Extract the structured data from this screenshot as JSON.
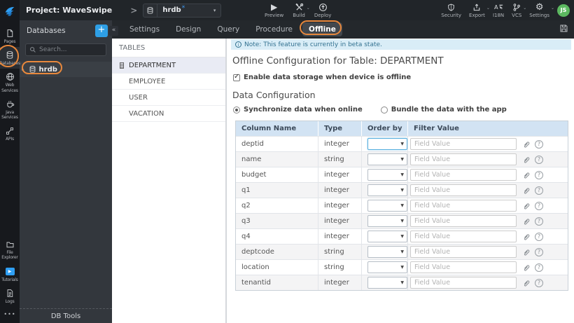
{
  "topbar": {
    "project_label": "Project: WaveSwipe",
    "breadcrumb_separator": ">",
    "db_selector": {
      "value": "hrdb",
      "unsaved_marker": "*",
      "caret": "▾"
    },
    "actions": [
      {
        "label": "Preview",
        "icon": "play-icon"
      },
      {
        "label": "Build",
        "icon": "tools-icon",
        "has_caret": true
      },
      {
        "label": "Deploy",
        "icon": "deploy-circle-up-icon"
      }
    ],
    "utilities": [
      {
        "label": "Security",
        "icon": "shield-icon"
      },
      {
        "label": "Export",
        "icon": "export-up-icon",
        "has_caret": true
      },
      {
        "label": "I18N",
        "icon": "translate-icon"
      },
      {
        "label": "VCS",
        "icon": "branch-icon",
        "has_caret": true
      },
      {
        "label": "Settings",
        "icon": "gear-icon",
        "has_caret": true
      }
    ],
    "avatar_initials": "JS",
    "caret_glyph": "⌄"
  },
  "activity_bar": {
    "items": [
      {
        "label": "Pages",
        "icon": "page-icon"
      },
      {
        "label": "Databases",
        "icon": "database-icon",
        "active": true
      },
      {
        "label": "Web Services",
        "icon": "globe-icon"
      },
      {
        "label": "Java Services",
        "icon": "coffee-icon"
      },
      {
        "label": "APIs",
        "icon": "nodes-icon"
      }
    ],
    "bottom_items": [
      {
        "label": "File Explorer",
        "icon": "folder-icon"
      },
      {
        "label": "Tutorials",
        "icon": "play-badge-icon"
      },
      {
        "label": "Logs",
        "icon": "log-file-icon"
      }
    ],
    "overflow": "•••"
  },
  "db_panel": {
    "title": "Databases",
    "add_button": "+",
    "collapse_button": "«",
    "search_placeholder": "Search...",
    "expander_glyph": "▸",
    "items": [
      {
        "label": "hrdb"
      }
    ],
    "footer": "DB Tools"
  },
  "tabs": {
    "items": [
      {
        "label": "Settings"
      },
      {
        "label": "Design"
      },
      {
        "label": "Query"
      },
      {
        "label": "Procedure"
      },
      {
        "label": "Offline",
        "active": true
      }
    ]
  },
  "tables_panel": {
    "header": "TABLES",
    "selected": "DEPARTMENT",
    "items": [
      "DEPARTMENT",
      "EMPLOYEE",
      "USER",
      "VACATION"
    ]
  },
  "content": {
    "note": "Note: This feature is currently in beta state.",
    "note_icon": "i",
    "title": "Offline Configuration for Table: DEPARTMENT",
    "enable_checkbox": {
      "label": "Enable data storage when device is offline",
      "checked": true
    },
    "section_title": "Data Configuration",
    "sync_options": [
      {
        "label": "Synchronize data when online",
        "selected": true
      },
      {
        "label": "Bundle the data with the app",
        "selected": false
      }
    ],
    "table": {
      "headers": [
        "Column Name",
        "Type",
        "Order by",
        "Filter Value"
      ],
      "filter_placeholder": "Field Value",
      "select_caret": "▼",
      "rows": [
        {
          "name": "deptid",
          "type": "integer"
        },
        {
          "name": "name",
          "type": "string"
        },
        {
          "name": "budget",
          "type": "integer"
        },
        {
          "name": "q1",
          "type": "integer"
        },
        {
          "name": "q2",
          "type": "integer"
        },
        {
          "name": "q3",
          "type": "integer"
        },
        {
          "name": "q4",
          "type": "integer"
        },
        {
          "name": "deptcode",
          "type": "string"
        },
        {
          "name": "location",
          "type": "string"
        },
        {
          "name": "tenantid",
          "type": "integer"
        }
      ]
    }
  },
  "colors": {
    "accent_blue": "#2e9fe6",
    "annotation_orange": "#e8883c",
    "note_bg": "#d9edf7",
    "note_text": "#31708f",
    "table_header_bg": "#d2e3f3",
    "selected_row_bg": "#e9ebf4",
    "avatar_green": "#5cb860"
  }
}
